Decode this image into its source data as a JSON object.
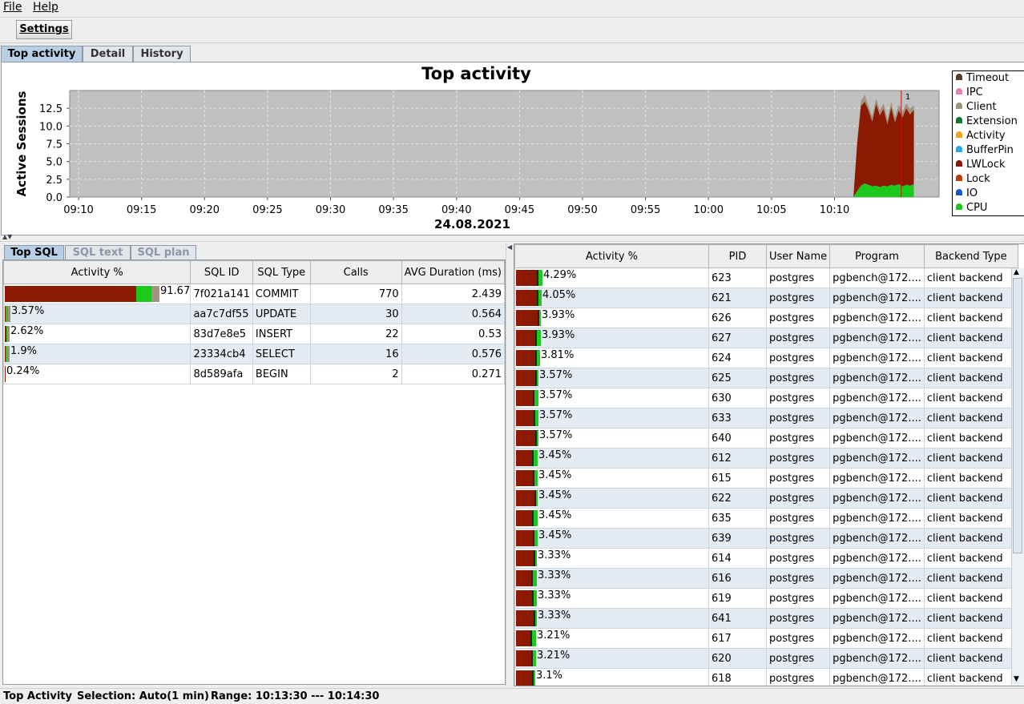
{
  "menu": {
    "file": "File",
    "help": "Help"
  },
  "toolbar": {
    "settings_label": "Settings"
  },
  "tabs": {
    "top_activity": "Top activity",
    "detail": "Detail",
    "history": "History"
  },
  "chart_data": {
    "type": "area",
    "title": "Top activity",
    "xlabel": "24.08.2021",
    "ylabel": "Active Sessions",
    "ylim": [
      0,
      15
    ],
    "yticks": [
      "0.0",
      "2.5",
      "5.0",
      "7.5",
      "10.0",
      "12.5"
    ],
    "xticks": [
      "09:10",
      "09:15",
      "09:20",
      "09:25",
      "09:30",
      "09:35",
      "09:40",
      "09:45",
      "09:50",
      "09:55",
      "10:00",
      "10:05",
      "10:10"
    ],
    "grid": true,
    "marker_label": "1",
    "legend": [
      {
        "name": "Timeout",
        "color": "#5a3a22"
      },
      {
        "name": "IPC",
        "color": "#e87fb8"
      },
      {
        "name": "Client",
        "color": "#a09480"
      },
      {
        "name": "Extension",
        "color": "#0b7a2e"
      },
      {
        "name": "Activity",
        "color": "#f2a31b"
      },
      {
        "name": "BufferPin",
        "color": "#23a7e6"
      },
      {
        "name": "LWLock",
        "color": "#8b1a00"
      },
      {
        "name": "Lock",
        "color": "#c0390b"
      },
      {
        "name": "IO",
        "color": "#1456d6"
      },
      {
        "name": "CPU",
        "color": "#1ec91e"
      }
    ],
    "series_time_minutes_after_0910": [
      62.2,
      62.5,
      62.8,
      63.1,
      63.4,
      63.7,
      64.0,
      64.3,
      64.6,
      64.9,
      65.2,
      65.5,
      65.8,
      66.1,
      66.4,
      66.7,
      67.0
    ],
    "cpu": [
      0,
      0.8,
      1.6,
      1.9,
      1.7,
      1.5,
      1.6,
      1.4,
      1.6,
      1.5,
      1.7,
      1.6,
      1.8,
      1.5,
      1.7,
      1.6,
      1.8
    ],
    "lwlock_top": [
      0,
      7.5,
      12.8,
      13.4,
      12.2,
      10.6,
      13.1,
      11.5,
      12.4,
      10.2,
      12.6,
      10.5,
      12.2,
      11.2,
      12.5,
      11.6,
      12.3
    ],
    "client_top": [
      0,
      8.0,
      13.5,
      14.4,
      12.8,
      11.4,
      13.9,
      12.2,
      13.2,
      10.9,
      13.4,
      11.2,
      13.0,
      12.0,
      13.2,
      12.4,
      13.0
    ]
  },
  "subtabs": {
    "top_sql": "Top SQL",
    "sql_text": "SQL text",
    "sql_plan": "SQL plan"
  },
  "sql_table": {
    "headers": [
      "Activity %",
      "SQL ID",
      "SQL Type",
      "Calls",
      "AVG Duration (ms)"
    ],
    "rows": [
      {
        "activity": "91.67%",
        "pct": 91.67,
        "sql_id": "7f021a141",
        "type": "COMMIT",
        "calls": "770",
        "avg": "2.439"
      },
      {
        "activity": "3.57%",
        "pct": 3.57,
        "sql_id": "aa7c7df55",
        "type": "UPDATE",
        "calls": "30",
        "avg": "0.564"
      },
      {
        "activity": "2.62%",
        "pct": 2.62,
        "sql_id": "83d7e8e5",
        "type": "INSERT",
        "calls": "22",
        "avg": "0.53"
      },
      {
        "activity": "1.9%",
        "pct": 1.9,
        "sql_id": "23334cb4",
        "type": "SELECT",
        "calls": "16",
        "avg": "0.576"
      },
      {
        "activity": "0.24%",
        "pct": 0.24,
        "sql_id": "8d589afa",
        "type": "BEGIN",
        "calls": "2",
        "avg": "0.271"
      }
    ]
  },
  "session_table": {
    "headers": [
      "Activity %",
      "PID",
      "User Name",
      "Program",
      "Backend Type"
    ],
    "rows": [
      {
        "activity": "4.29%",
        "pct": 4.29,
        "pid": "623",
        "user": "postgres",
        "program": "pgbench@172....",
        "backend": "client backend"
      },
      {
        "activity": "4.05%",
        "pct": 4.05,
        "pid": "621",
        "user": "postgres",
        "program": "pgbench@172....",
        "backend": "client backend"
      },
      {
        "activity": "3.93%",
        "pct": 3.93,
        "pid": "626",
        "user": "postgres",
        "program": "pgbench@172....",
        "backend": "client backend"
      },
      {
        "activity": "3.93%",
        "pct": 3.93,
        "pid": "627",
        "user": "postgres",
        "program": "pgbench@172....",
        "backend": "client backend"
      },
      {
        "activity": "3.81%",
        "pct": 3.81,
        "pid": "624",
        "user": "postgres",
        "program": "pgbench@172....",
        "backend": "client backend"
      },
      {
        "activity": "3.57%",
        "pct": 3.57,
        "pid": "625",
        "user": "postgres",
        "program": "pgbench@172....",
        "backend": "client backend"
      },
      {
        "activity": "3.57%",
        "pct": 3.57,
        "pid": "630",
        "user": "postgres",
        "program": "pgbench@172....",
        "backend": "client backend"
      },
      {
        "activity": "3.57%",
        "pct": 3.57,
        "pid": "633",
        "user": "postgres",
        "program": "pgbench@172....",
        "backend": "client backend"
      },
      {
        "activity": "3.57%",
        "pct": 3.57,
        "pid": "640",
        "user": "postgres",
        "program": "pgbench@172....",
        "backend": "client backend"
      },
      {
        "activity": "3.45%",
        "pct": 3.45,
        "pid": "612",
        "user": "postgres",
        "program": "pgbench@172....",
        "backend": "client backend"
      },
      {
        "activity": "3.45%",
        "pct": 3.45,
        "pid": "615",
        "user": "postgres",
        "program": "pgbench@172....",
        "backend": "client backend"
      },
      {
        "activity": "3.45%",
        "pct": 3.45,
        "pid": "622",
        "user": "postgres",
        "program": "pgbench@172....",
        "backend": "client backend"
      },
      {
        "activity": "3.45%",
        "pct": 3.45,
        "pid": "635",
        "user": "postgres",
        "program": "pgbench@172....",
        "backend": "client backend"
      },
      {
        "activity": "3.45%",
        "pct": 3.45,
        "pid": "639",
        "user": "postgres",
        "program": "pgbench@172....",
        "backend": "client backend"
      },
      {
        "activity": "3.33%",
        "pct": 3.33,
        "pid": "614",
        "user": "postgres",
        "program": "pgbench@172....",
        "backend": "client backend"
      },
      {
        "activity": "3.33%",
        "pct": 3.33,
        "pid": "616",
        "user": "postgres",
        "program": "pgbench@172....",
        "backend": "client backend"
      },
      {
        "activity": "3.33%",
        "pct": 3.33,
        "pid": "619",
        "user": "postgres",
        "program": "pgbench@172....",
        "backend": "client backend"
      },
      {
        "activity": "3.33%",
        "pct": 3.33,
        "pid": "641",
        "user": "postgres",
        "program": "pgbench@172....",
        "backend": "client backend"
      },
      {
        "activity": "3.21%",
        "pct": 3.21,
        "pid": "617",
        "user": "postgres",
        "program": "pgbench@172....",
        "backend": "client backend"
      },
      {
        "activity": "3.21%",
        "pct": 3.21,
        "pid": "620",
        "user": "postgres",
        "program": "pgbench@172....",
        "backend": "client backend"
      },
      {
        "activity": "3.1%",
        "pct": 3.1,
        "pid": "618",
        "user": "postgres",
        "program": "pgbench@172....",
        "backend": "client backend"
      }
    ]
  },
  "colors": {
    "lwlock": "#8b1a00",
    "cpu": "#1ec91e",
    "client": "#a09480",
    "plot_bg": "#c0c0c0",
    "selected_tab": "#b8cfe5",
    "row_alt": "#e4ebf3"
  },
  "status": {
    "view": "Top Activity",
    "selection": "Selection: Auto(1 min)",
    "range": "Range: 10:13:30 --- 10:14:30"
  }
}
